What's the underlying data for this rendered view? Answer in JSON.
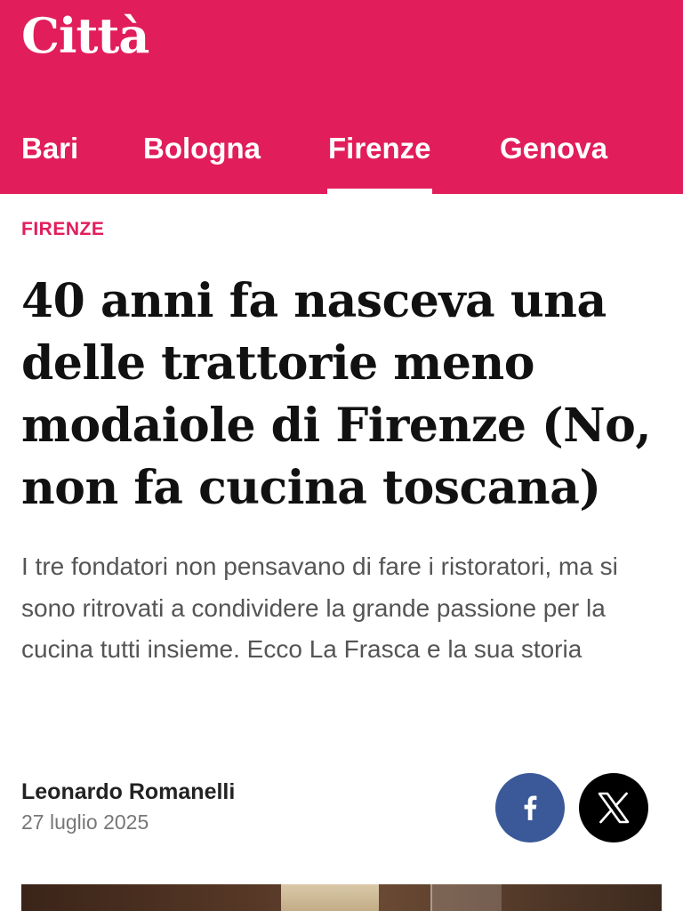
{
  "brand": {
    "logo": "Città"
  },
  "nav": {
    "items": [
      {
        "label": "Bari"
      },
      {
        "label": "Bologna"
      },
      {
        "label": "Firenze",
        "active": true
      },
      {
        "label": "Genova"
      }
    ]
  },
  "article": {
    "section": "FIRENZE",
    "headline": "40 anni fa nasceva una delle trattorie meno modaiole di Firenze (No, non fa cucina toscana)",
    "summary": "I tre fondatori non pensavano di fare i ristoratori, ma si sono ritrovati a condividere la grande passione per la cucina tutti insieme. Ecco La Frasca e la sua storia",
    "author": "Leonardo Romanelli",
    "date": "27 luglio 2025"
  },
  "share": {
    "facebook_icon": "facebook-icon",
    "x_icon": "x-icon"
  },
  "colors": {
    "brand": "#e21d5b",
    "facebook": "#3b5998",
    "x": "#000000"
  }
}
